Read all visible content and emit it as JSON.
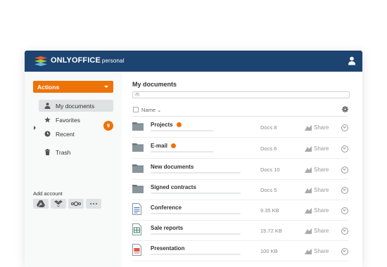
{
  "app": {
    "brand": "ONLYOFFICE",
    "brand_sub": "personal"
  },
  "sidebar": {
    "actions_label": "Actions",
    "items": [
      {
        "label": "My documents",
        "icon": "person-icon",
        "active": true,
        "badge": "9"
      },
      {
        "label": "Favorites",
        "icon": "star-icon"
      },
      {
        "label": "Recent",
        "icon": "clock-icon"
      },
      {
        "label": "Trash",
        "icon": "trash-icon"
      }
    ],
    "add_account_label": "Add account",
    "accounts": [
      "google-drive-icon",
      "dropbox-icon",
      "nextcloud-icon",
      "more-icon"
    ]
  },
  "main": {
    "title": "My documents",
    "search_pill": "×",
    "column_name": "Name",
    "share_label": "Share",
    "rows": [
      {
        "name": "Projects",
        "type": "folder",
        "meta": "Docs 8",
        "new": true
      },
      {
        "name": "E-mail",
        "type": "folder",
        "meta": "Docs 6",
        "new": true
      },
      {
        "name": "New documents",
        "type": "folder",
        "meta": "Docs 10",
        "new": false
      },
      {
        "name": "Signed contracts",
        "type": "folder",
        "meta": "Docs 5",
        "new": false
      },
      {
        "name": "Conference",
        "type": "document",
        "meta": "9.35 KB",
        "new": false
      },
      {
        "name": "Sale reports",
        "type": "spreadsheet",
        "meta": "15.72 KB",
        "new": false
      },
      {
        "name": "Presentation",
        "type": "presentation",
        "meta": "100 KB",
        "new": false
      }
    ]
  },
  "colors": {
    "header": "#1d4471",
    "accent": "#ed7309",
    "sidebar": "#f8f9f9"
  }
}
